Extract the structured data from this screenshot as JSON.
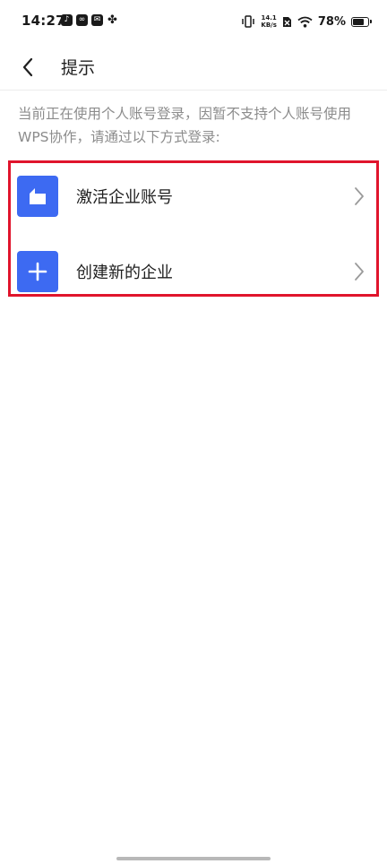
{
  "status_bar": {
    "time": "14:27",
    "net_speed_value": "14.1",
    "net_speed_unit": "KB/s",
    "battery_percent": "78%",
    "battery_level": 0.78
  },
  "header": {
    "title": "提示"
  },
  "hint": {
    "text": "当前正在使用个人账号登录，因暂不支持个人账号使用WPS协作，请通过以下方式登录:"
  },
  "options": [
    {
      "label": "激活企业账号",
      "icon": "building-icon"
    },
    {
      "label": "创建新的企业",
      "icon": "plus-icon"
    }
  ],
  "colors": {
    "accent": "#3d6af2",
    "highlight_border": "#e0142c",
    "hint_text": "#8c8c8c"
  }
}
